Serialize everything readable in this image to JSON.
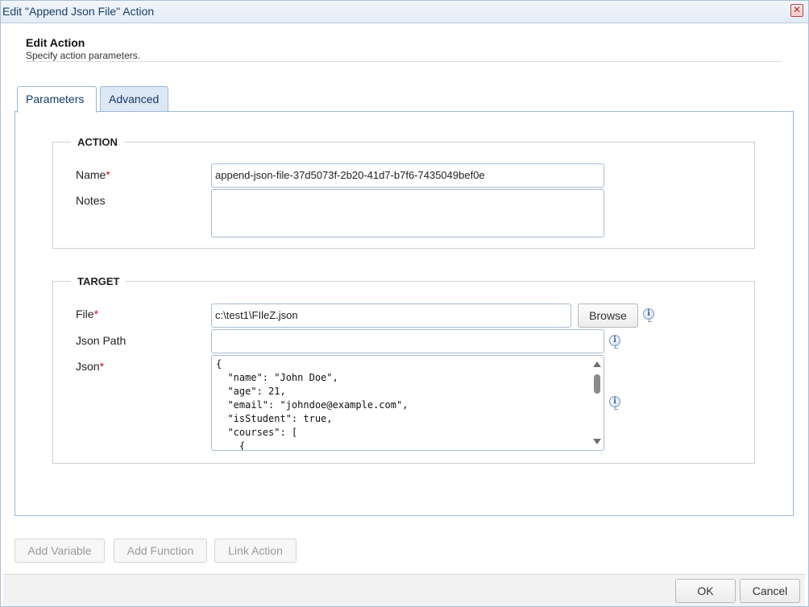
{
  "window": {
    "title": "Edit \"Append Json File\" Action",
    "close_glyph": "✕"
  },
  "header": {
    "title": "Edit Action",
    "subtitle": "Specify action parameters."
  },
  "tabs": [
    {
      "label": "Parameters",
      "active": true
    },
    {
      "label": "Advanced",
      "active": false
    }
  ],
  "action_section": {
    "legend": "ACTION",
    "name_label": "Name",
    "name_value": "append-json-file-37d5073f-2b20-41d7-b7f6-7435049bef0e",
    "notes_label": "Notes",
    "notes_value": ""
  },
  "target_section": {
    "legend": "TARGET",
    "file_label": "File",
    "file_value": "c:\\test1\\FIleZ.json",
    "browse_label": "Browse",
    "json_path_label": "Json Path",
    "json_path_value": "",
    "json_label": "Json",
    "json_value": "{\n  \"name\": \"John Doe\",\n  \"age\": 21,\n  \"email\": \"johndoe@example.com\",\n  \"isStudent\": true,\n  \"courses\": [\n    {"
  },
  "required_marker": "*",
  "info_glyph": "i",
  "bottom_buttons": {
    "add_variable": "Add Variable",
    "add_function": "Add Function",
    "link_action": "Link Action"
  },
  "footer": {
    "ok": "OK",
    "cancel": "Cancel"
  },
  "icons": {
    "close": "close-icon",
    "info": "info-icon",
    "scroll_up": "scroll-up-arrow-icon",
    "scroll_down": "scroll-down-arrow-icon"
  },
  "colors": {
    "titlebar_text": "#1d3d66",
    "required": "#c01818",
    "tab_border": "#9fb8d3"
  }
}
